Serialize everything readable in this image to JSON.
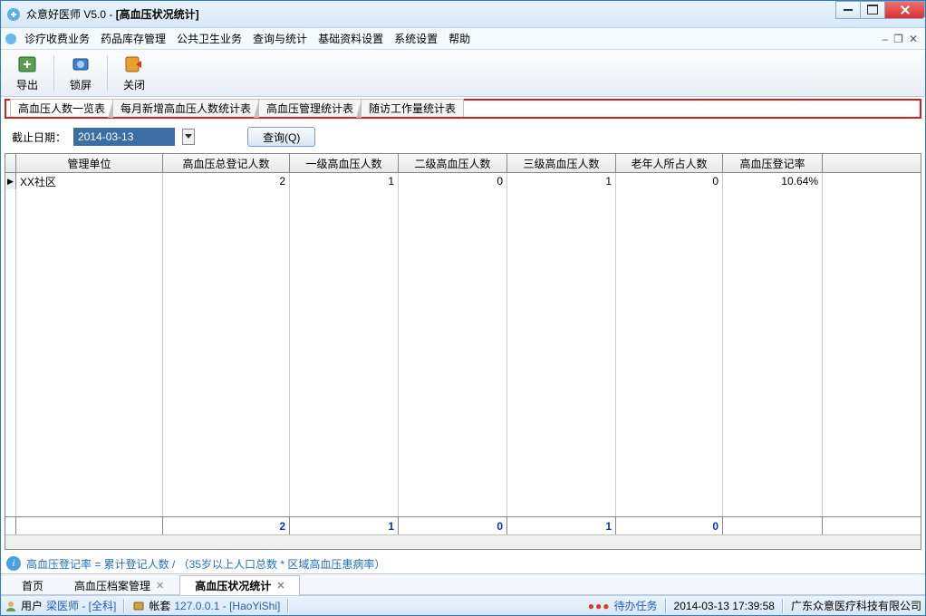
{
  "window": {
    "title_prefix": "众意好医师 V5.0 - ",
    "title_doc": "[高血压状况统计]"
  },
  "menu": {
    "items": [
      "诊疗收费业务",
      "药品库存管理",
      "公共卫生业务",
      "查询与统计",
      "基础资料设置",
      "系统设置",
      "帮助"
    ]
  },
  "toolbar": {
    "export": "导出",
    "lock": "锁屏",
    "close": "关闭"
  },
  "subtabs": [
    "高血压人数一览表",
    "每月新增高血压人数统计表",
    "高血压管理统计表",
    "随访工作量统计表"
  ],
  "query": {
    "label": "截止日期：",
    "date": "2014-03-13",
    "button": "查询(Q)"
  },
  "grid": {
    "headers": [
      "管理单位",
      "高血压总登记人数",
      "一级高血压人数",
      "二级高血压人数",
      "三级高血压人数",
      "老年人所占人数",
      "高血压登记率"
    ],
    "rows": [
      {
        "unit": "XX社区",
        "total": "2",
        "l1": "1",
        "l2": "0",
        "l3": "1",
        "elderly": "0",
        "rate": "10.64%"
      }
    ],
    "footer": [
      "",
      "2",
      "1",
      "0",
      "1",
      "0",
      ""
    ]
  },
  "info": "高血压登记率 = 累计登记人数 / （35岁以上人口总数 * 区域高血压患病率）",
  "doctabs": {
    "items": [
      "首页",
      "高血压档案管理",
      "高血压状况统计"
    ],
    "active": 2
  },
  "status": {
    "user_label": "用户",
    "user_value": "梁医师 - [全科]",
    "acct_label": "帐套",
    "acct_value": "127.0.0.1 - [HaoYiShi]",
    "todo": "待办任务",
    "datetime": "2014-03-13 17:39:58",
    "company": "广东众意医疗科技有限公司"
  }
}
